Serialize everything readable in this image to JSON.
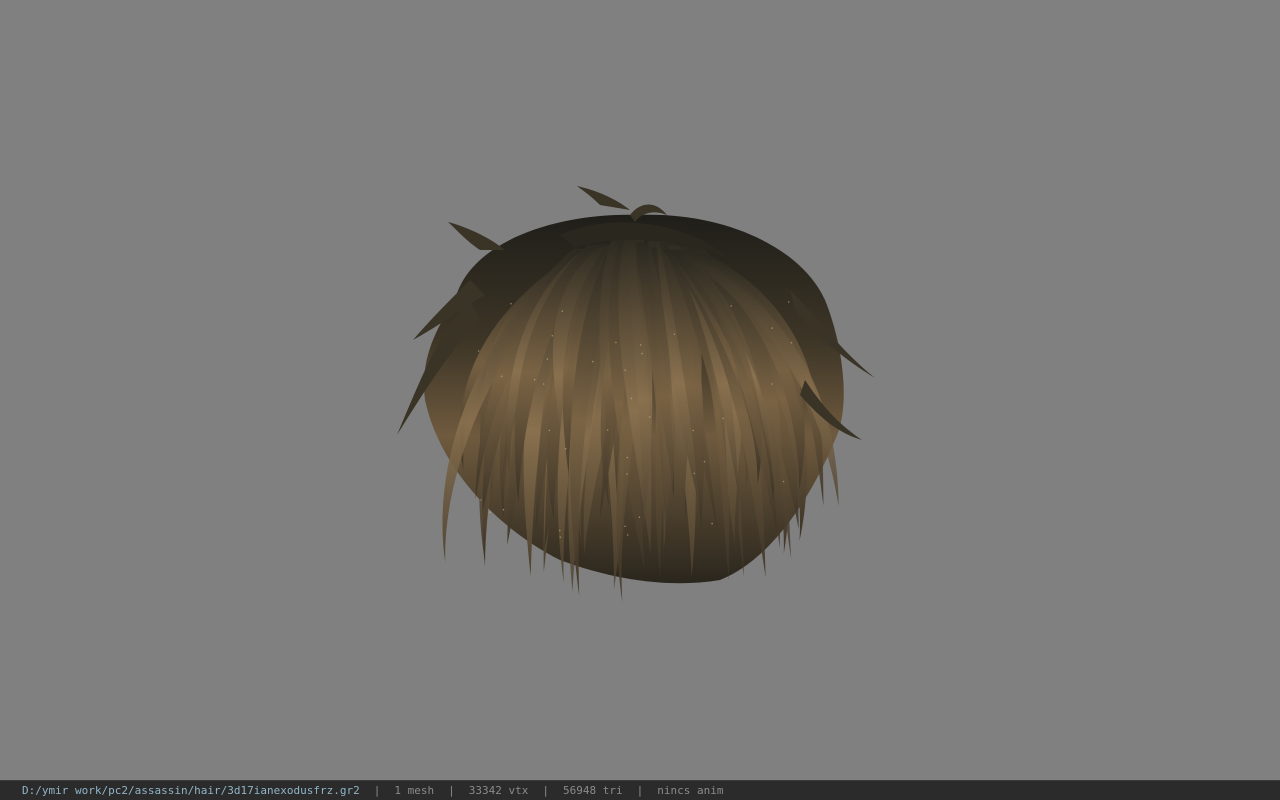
{
  "viewport": {
    "background": "#808080",
    "model_name": "hair-mesh",
    "hair_colors": {
      "root": "#26241d",
      "mid": "#5a4a33",
      "tip": "#7d6647"
    }
  },
  "status_bar": {
    "file_path": "D:/ymir work/pc2/assassin/hair/3d17ianexodusfrz.gr2",
    "separator": "|",
    "mesh_count": "1 mesh",
    "vertex_count": "33342 vtx",
    "triangle_count": "56948 tri",
    "anim_status": "nincs anim"
  }
}
